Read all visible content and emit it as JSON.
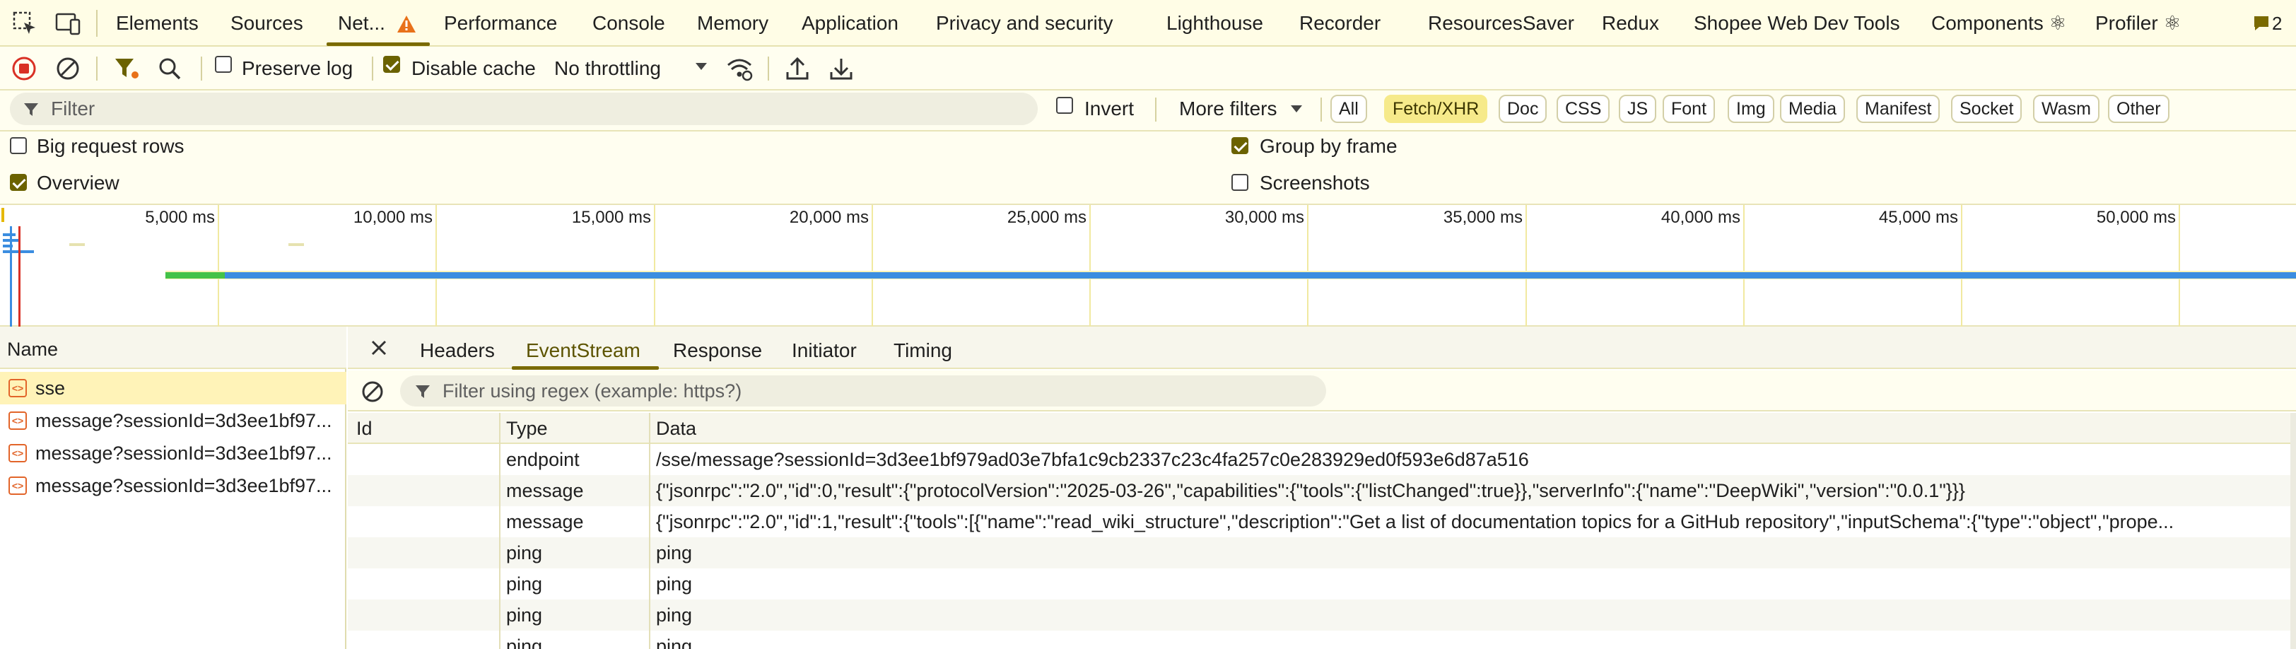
{
  "tabs": [
    {
      "label": "Elements"
    },
    {
      "label": "Sources"
    },
    {
      "label": "Net..."
    },
    {
      "label": "Performance"
    },
    {
      "label": "Console"
    },
    {
      "label": "Memory"
    },
    {
      "label": "Application"
    },
    {
      "label": "Privacy and security"
    },
    {
      "label": "Lighthouse"
    },
    {
      "label": "Recorder"
    },
    {
      "label": "ResourcesSaver"
    },
    {
      "label": "Redux"
    },
    {
      "label": "Shopee Web Dev Tools"
    },
    {
      "label": "Components ⚛"
    },
    {
      "label": "Profiler ⚛"
    }
  ],
  "issues_count": "2",
  "toolbar": {
    "preserve_log": "Preserve log",
    "disable_cache": "Disable cache",
    "throttling": "No throttling"
  },
  "filter": {
    "placeholder": "Filter",
    "invert": "Invert",
    "more_filters": "More filters",
    "types": [
      "All",
      "Fetch/XHR",
      "Doc",
      "CSS",
      "JS",
      "Font",
      "Img",
      "Media",
      "Manifest",
      "Socket",
      "Wasm",
      "Other"
    ]
  },
  "options": {
    "big_request_rows": "Big request rows",
    "overview": "Overview",
    "group_by_frame": "Group by frame",
    "screenshots": "Screenshots"
  },
  "timeline": {
    "ticks": [
      "5,000 ms",
      "10,000 ms",
      "15,000 ms",
      "20,000 ms",
      "25,000 ms",
      "30,000 ms",
      "35,000 ms",
      "40,000 ms",
      "45,000 ms",
      "50,000 ms"
    ]
  },
  "requests": {
    "header": "Name",
    "items": [
      {
        "name": "sse"
      },
      {
        "name": "message?sessionId=3d3ee1bf97..."
      },
      {
        "name": "message?sessionId=3d3ee1bf97..."
      },
      {
        "name": "message?sessionId=3d3ee1bf97..."
      }
    ]
  },
  "detail": {
    "tabs": [
      "Headers",
      "EventStream",
      "Response",
      "Initiator",
      "Timing"
    ],
    "filter_placeholder": "Filter using regex (example: https?)",
    "columns": [
      "Id",
      "Type",
      "Data"
    ],
    "rows": [
      {
        "id": "",
        "type": "endpoint",
        "data": "/sse/message?sessionId=3d3ee1bf979ad03e7bfa1c9cb2337c23c4fa257c0e283929ed0f593e6d87a516"
      },
      {
        "id": "",
        "type": "message",
        "data": "{\"jsonrpc\":\"2.0\",\"id\":0,\"result\":{\"protocolVersion\":\"2025-03-26\",\"capabilities\":{\"tools\":{\"listChanged\":true}},\"serverInfo\":{\"name\":\"DeepWiki\",\"version\":\"0.0.1\"}}}"
      },
      {
        "id": "",
        "type": "message",
        "data": "{\"jsonrpc\":\"2.0\",\"id\":1,\"result\":{\"tools\":[{\"name\":\"read_wiki_structure\",\"description\":\"Get a list of documentation topics for a GitHub repository\",\"inputSchema\":{\"type\":\"object\",\"prope..."
      },
      {
        "id": "",
        "type": "ping",
        "data": "ping"
      },
      {
        "id": "",
        "type": "ping",
        "data": "ping"
      },
      {
        "id": "",
        "type": "ping",
        "data": "ping"
      },
      {
        "id": "",
        "type": "ping",
        "data": "ping"
      }
    ]
  },
  "colors": {
    "accent": "#7a6a00",
    "selected_pill": "#f6ea8a",
    "warning": "#e8711a",
    "record": "#d93025",
    "timeline_blue": "#3b8de0",
    "timeline_green": "#44c248"
  }
}
